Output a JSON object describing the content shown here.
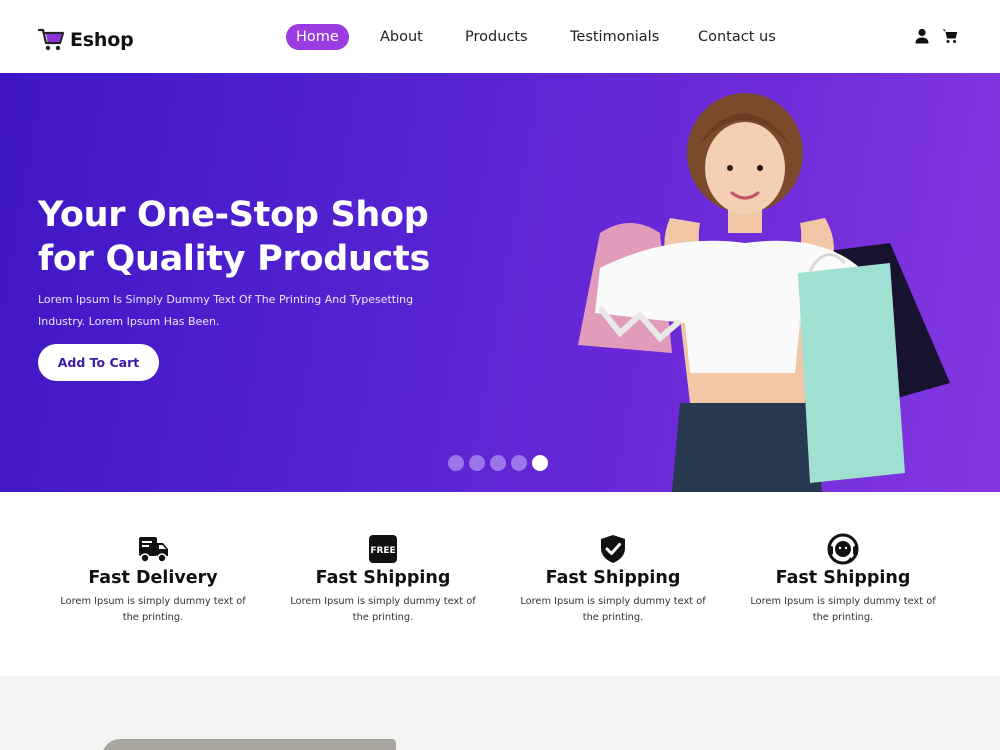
{
  "brand": {
    "name": "Eshop",
    "accent": "#9b3ce0"
  },
  "nav": {
    "items": [
      {
        "label": "Home",
        "active": true
      },
      {
        "label": "About",
        "active": false
      },
      {
        "label": "Products",
        "active": false
      },
      {
        "label": "Testimonials",
        "active": false
      },
      {
        "label": "Contact us",
        "active": false
      }
    ]
  },
  "header_icons": [
    "user-icon",
    "cart-icon"
  ],
  "hero": {
    "title_line1": "Your One-Stop Shop",
    "title_line2": "for Quality Products",
    "description": "Lorem Ipsum Is Simply Dummy Text Of The Printing And Typesetting Industry. Lorem Ipsum Has Been.",
    "button_label": "Add To Cart",
    "gradient": [
      "#3f16c4",
      "#8438e0"
    ],
    "carousel": {
      "total": 5,
      "active_index": 5
    }
  },
  "features": [
    {
      "icon": "delivery-truck-icon",
      "title": "Fast Delivery",
      "description": "Lorem Ipsum is simply dummy text of the printing."
    },
    {
      "icon": "free-badge-icon",
      "badge_text": "FREE",
      "title": "Fast Shipping",
      "description": "Lorem Ipsum is simply dummy text of the printing."
    },
    {
      "icon": "shield-check-icon",
      "title": "Fast Shipping",
      "description": "Lorem Ipsum is simply dummy text of the printing."
    },
    {
      "icon": "support-agent-icon",
      "title": "Fast Shipping",
      "description": "Lorem Ipsum is simply dummy text of the printing."
    }
  ]
}
